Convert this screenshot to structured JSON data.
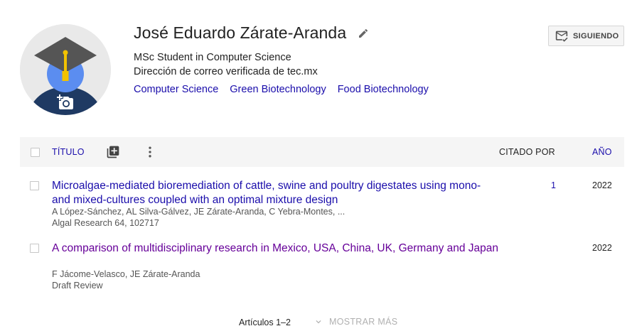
{
  "profile": {
    "name": "José Eduardo Zárate-Aranda",
    "affiliation": "MSc Student in Computer Science",
    "email_line": "Dirección de correo verificada de tec.mx",
    "interests": [
      "Computer Science",
      "Green Biotechnology",
      "Food Biotechnology"
    ],
    "follow_label": "SIGUIENDO"
  },
  "table": {
    "title_header": "TÍTULO",
    "cited_header": "CITADO POR",
    "year_header": "AÑO",
    "articles": [
      {
        "title": "Microalgae-mediated bioremediation of cattle, swine and poultry digestates using mono- and mixed-cultures coupled with an optimal mixture design",
        "authors": "A López-Sánchez, AL Silva-Gálvez, JE Zárate-Aranda, C Yebra-Montes, ...",
        "venue": "Algal Research 64, 102717",
        "cited": "1",
        "year": "2022"
      },
      {
        "title": "A comparison of multidisciplinary research in Mexico, USA, China, UK, Germany and Japan",
        "authors": "F Jácome-Velasco, JE Zárate-Aranda",
        "venue": "Draft Review",
        "cited": "",
        "year": "2022"
      }
    ]
  },
  "footer": {
    "count": "Artículos 1–2",
    "show_more": "MOSTRAR MÁS"
  },
  "colors": {
    "link": "#1a0dab",
    "visited": "#660099",
    "header_bg": "#f5f5f5"
  },
  "icons": {
    "avatar": "graduation-cap-avatar",
    "camera": "add-photo-icon",
    "edit": "pencil-icon",
    "follow": "mail-check-icon",
    "add": "add-box-icon",
    "more": "more-vert-icon",
    "chevron": "chevron-down-icon"
  }
}
